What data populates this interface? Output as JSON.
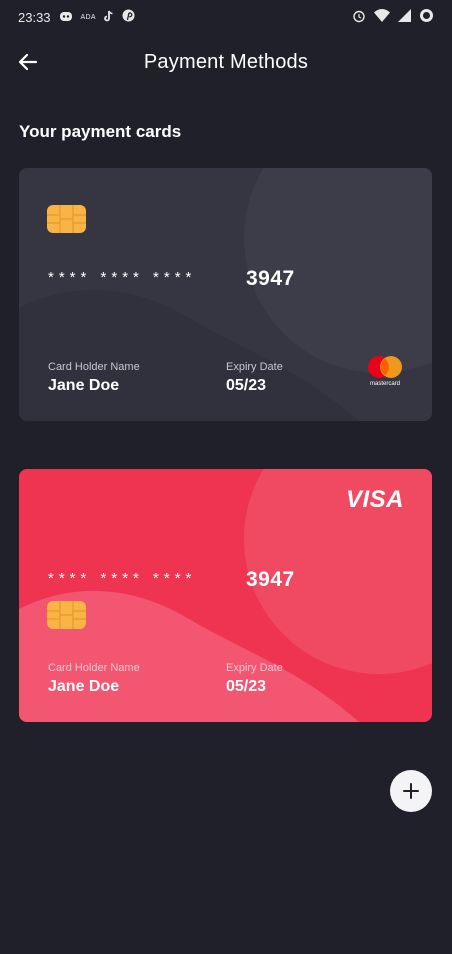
{
  "status_bar": {
    "time": "23:33",
    "notification_icons": [
      "discord-icon",
      "ada-icon",
      "tiktok-icon",
      "pinterest-icon"
    ],
    "ada_label": "ADA",
    "system_icons": [
      "alarm-icon",
      "wifi-icon",
      "signal-icon",
      "battery-icon"
    ]
  },
  "header": {
    "title": "Payment Methods",
    "back_icon": "arrow-left-icon"
  },
  "section": {
    "title": "Your payment cards"
  },
  "cards": [
    {
      "masked_number": "**** **** ****",
      "last_digits": "3947",
      "holder_label": "Card Holder Name",
      "holder_name": "Jane Doe",
      "expiry_label": "Expiry Date",
      "expiry_value": "05/23",
      "network": "mastercard",
      "network_label": "mastercard",
      "color": "#353641"
    },
    {
      "masked_number": "**** **** ****",
      "last_digits": "3947",
      "holder_label": "Card Holder Name",
      "holder_name": "Jane Doe",
      "expiry_label": "Expiry Date",
      "expiry_value": "05/23",
      "network": "VISA",
      "network_label": "VISA",
      "color": "#ef3452"
    }
  ],
  "fab": {
    "icon": "plus-icon"
  },
  "colors": {
    "background": "#1f2029",
    "chip": "#f8b545",
    "accent_red": "#ef3452"
  }
}
